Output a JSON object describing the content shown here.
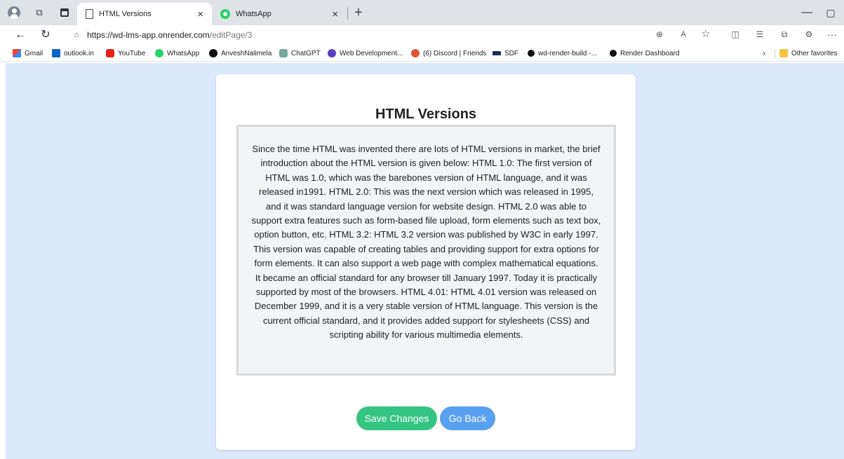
{
  "browser": {
    "tabs": [
      {
        "title": "HTML Versions",
        "close": "×"
      },
      {
        "title": "WhatsApp",
        "close": "×"
      }
    ],
    "new_tab": "+",
    "window": {
      "minimize": "—",
      "maximize": "▢"
    },
    "address": {
      "url_host": "https://wd-lms-app.onrender.com",
      "url_path": "/editPage/3"
    },
    "icons": {
      "back": "←",
      "refresh": "↻",
      "lock": "⌂",
      "zoom": "⊕",
      "read_aloud": "A",
      "favorite": "☆",
      "split": "◫",
      "favorites": "☰",
      "collections": "⧉",
      "extensions": "⚙",
      "more": "···",
      "chevron": "›"
    },
    "bookmarks": [
      {
        "label": "Gmail"
      },
      {
        "label": "outlook.in"
      },
      {
        "label": "YouTube"
      },
      {
        "label": "WhatsApp"
      },
      {
        "label": "AnveshNalimela"
      },
      {
        "label": "ChatGPT"
      },
      {
        "label": "Web Development..."
      },
      {
        "label": "(6) Discord | Friends"
      },
      {
        "label": "SDF"
      },
      {
        "label": "wd-render-build -..."
      },
      {
        "label": "Render Dashboard"
      }
    ],
    "other_favorites": "Other favorites"
  },
  "page": {
    "title": "HTML Versions",
    "content": "Since the time HTML was invented there are lots of HTML versions in market, the brief introduction about the HTML version is given below: HTML 1.0: The first version of HTML was 1.0, which was the barebones version of HTML language, and it was released in1991. HTML 2.0: This was the next version which was released in 1995, and it was standard language version for website design. HTML 2.0 was able to support extra features such as form-based file upload, form elements such as text box, option button, etc. HTML 3.2: HTML 3.2 version was published by W3C in early 1997. This version was capable of creating tables and providing support for extra options for form elements. It can also support a web page with complex mathematical equations. It became an official standard for any browser till January 1997. Today it is practically supported by most of the browsers. HTML 4.01: HTML 4.01 version was released on December 1999, and it is a very stable version of HTML language. This version is the current official standard, and it provides added support for stylesheets (CSS) and scripting ability for various multimedia elements.",
    "save_label": "Save Changes",
    "back_label": "Go Back"
  },
  "colors": {
    "page_background": "#dce8fb",
    "save_button": "#34c483",
    "back_button": "#5aa0f0"
  }
}
